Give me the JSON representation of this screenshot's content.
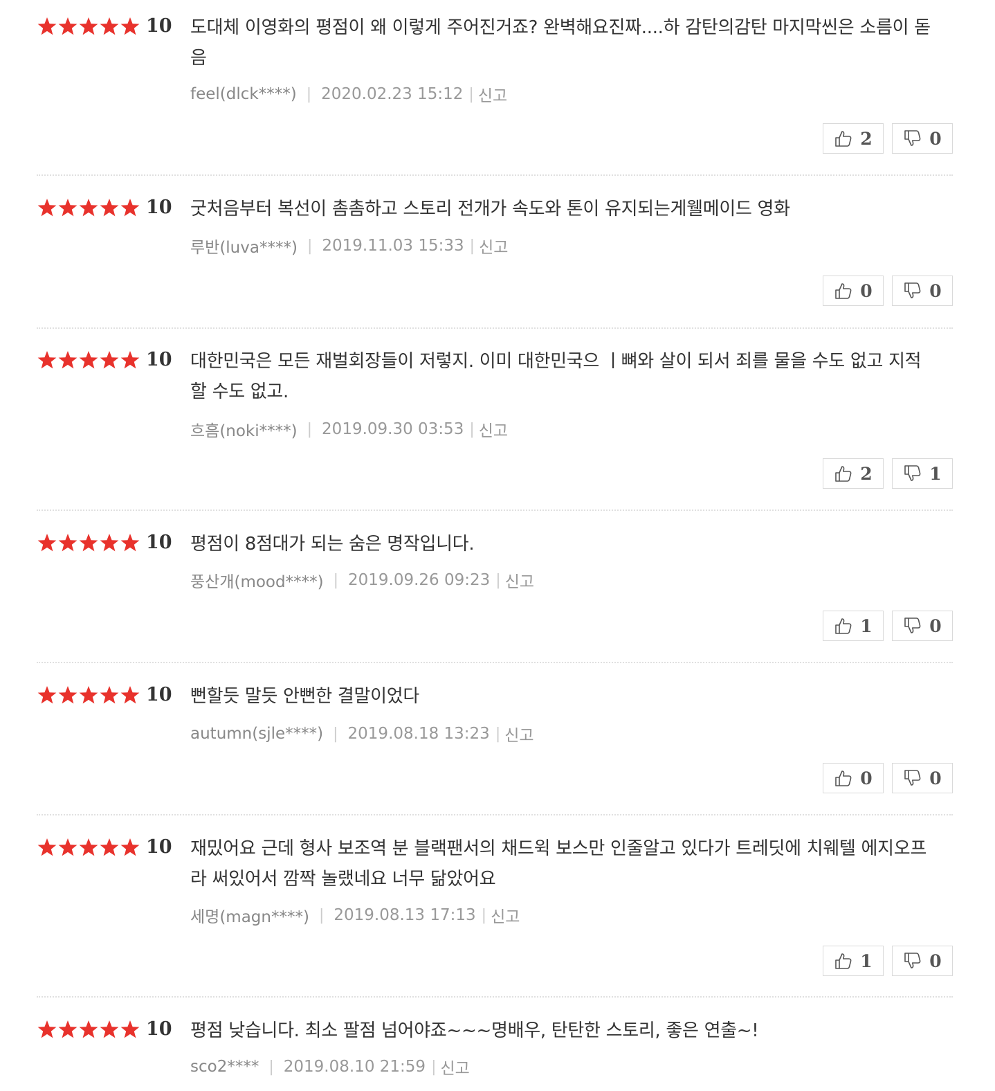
{
  "accent_color": "#e8322c",
  "reviews": [
    {
      "score": "10",
      "text": "도대체 이영화의 평점이 왜 이렇게 주어진거죠? 완벽해요진짜....하 감탄의감탄 마지막씬은 소름이 돋음",
      "user": "feel(dlck****)",
      "date": "2020.02.23 15:12",
      "report": "신고",
      "likes": "2",
      "dislikes": "0",
      "stars": 5
    },
    {
      "score": "10",
      "text": "굿처음부터 복선이 촘촘하고 스토리 전개가 속도와 톤이 유지되는게웰메이드 영화",
      "user": "루반(luva****)",
      "date": "2019.11.03 15:33",
      "report": "신고",
      "likes": "0",
      "dislikes": "0",
      "stars": 5
    },
    {
      "score": "10",
      "text": "대한민국은 모든 재벌회장들이 저렇지. 이미 대한민국으 ㅣ뼈와 살이 되서 죄를 물을 수도 없고 지적 할 수도 없고.",
      "user": "흐흠(noki****)",
      "date": "2019.09.30 03:53",
      "report": "신고",
      "likes": "2",
      "dislikes": "1",
      "stars": 5
    },
    {
      "score": "10",
      "text": "평점이 8점대가 되는 숨은 명작입니다.",
      "user": "풍산개(mood****)",
      "date": "2019.09.26 09:23",
      "report": "신고",
      "likes": "1",
      "dislikes": "0",
      "stars": 5
    },
    {
      "score": "10",
      "text": "뻔할듯 말듯 안뻔한 결말이었다",
      "user": "autumn(sjle****)",
      "date": "2019.08.18 13:23",
      "report": "신고",
      "likes": "0",
      "dislikes": "0",
      "stars": 5
    },
    {
      "score": "10",
      "text": "재밌어요 근데 형사 보조역 분 블랙팬서의 채드윅 보스만 인줄알고 있다가 트레딧에 치웨텔 에지오프라 써있어서 깜짝 놀랬네요 너무 닮았어요",
      "user": "세명(magn****)",
      "date": "2019.08.13 17:13",
      "report": "신고",
      "likes": "1",
      "dislikes": "0",
      "stars": 5
    },
    {
      "score": "10",
      "text": "평점 낮습니다. 최소 팔점 넘어야죠~~~명배우, 탄탄한 스토리, 좋은 연출~!",
      "user": "sco2****",
      "date": "2019.08.10 21:59",
      "report": "신고",
      "likes": "",
      "dislikes": "",
      "stars": 5
    }
  ]
}
